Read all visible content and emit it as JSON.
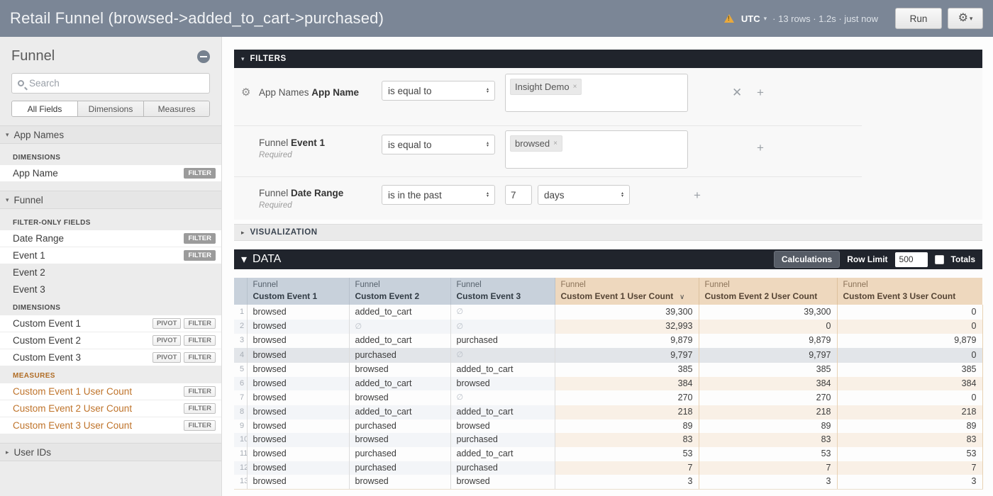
{
  "topbar": {
    "title": "Retail Funnel (browsed->added_to_cart->purchased)",
    "timezone": "UTC",
    "meta": "· 13 rows · 1.2s · just now",
    "run_label": "Run",
    "gear_glyph": "⚙"
  },
  "sidebar": {
    "title": "Funnel",
    "search_placeholder": "Search",
    "tabs": [
      {
        "label": "All Fields",
        "active": true
      },
      {
        "label": "Dimensions",
        "active": false
      },
      {
        "label": "Measures",
        "active": false
      }
    ],
    "groups": [
      {
        "label": "App Names",
        "expanded": true,
        "sections": [
          {
            "heading": "DIMENSIONS",
            "kind": "dimensions",
            "fields": [
              {
                "label": "App Name",
                "selected": true,
                "measure": false,
                "badges": [
                  {
                    "label": "FILTER",
                    "active": true
                  }
                ]
              }
            ]
          }
        ]
      },
      {
        "label": "Funnel",
        "expanded": true,
        "sections": [
          {
            "heading": "FILTER-ONLY FIELDS",
            "kind": "filter-only",
            "fields": [
              {
                "label": "Date Range",
                "selected": true,
                "measure": false,
                "badges": [
                  {
                    "label": "FILTER",
                    "active": true
                  }
                ]
              },
              {
                "label": "Event 1",
                "selected": true,
                "measure": false,
                "badges": [
                  {
                    "label": "FILTER",
                    "active": true
                  }
                ]
              },
              {
                "label": "Event 2",
                "selected": false,
                "measure": false,
                "badges": []
              },
              {
                "label": "Event 3",
                "selected": false,
                "measure": false,
                "badges": []
              }
            ]
          },
          {
            "heading": "DIMENSIONS",
            "kind": "dimensions",
            "fields": [
              {
                "label": "Custom Event 1",
                "selected": true,
                "measure": false,
                "badges": [
                  {
                    "label": "PIVOT",
                    "active": false
                  },
                  {
                    "label": "FILTER",
                    "active": false
                  }
                ]
              },
              {
                "label": "Custom Event 2",
                "selected": true,
                "measure": false,
                "badges": [
                  {
                    "label": "PIVOT",
                    "active": false
                  },
                  {
                    "label": "FILTER",
                    "active": false
                  }
                ]
              },
              {
                "label": "Custom Event 3",
                "selected": true,
                "measure": false,
                "badges": [
                  {
                    "label": "PIVOT",
                    "active": false
                  },
                  {
                    "label": "FILTER",
                    "active": false
                  }
                ]
              }
            ]
          },
          {
            "heading": "MEASURES",
            "kind": "measures",
            "fields": [
              {
                "label": "Custom Event 1 User Count",
                "selected": true,
                "measure": true,
                "badges": [
                  {
                    "label": "FILTER",
                    "active": false
                  }
                ]
              },
              {
                "label": "Custom Event 2 User Count",
                "selected": true,
                "measure": true,
                "badges": [
                  {
                    "label": "FILTER",
                    "active": false
                  }
                ]
              },
              {
                "label": "Custom Event 3 User Count",
                "selected": true,
                "measure": true,
                "badges": [
                  {
                    "label": "FILTER",
                    "active": false
                  }
                ]
              }
            ]
          }
        ]
      },
      {
        "label": "User IDs",
        "expanded": false,
        "sections": []
      }
    ]
  },
  "filters": {
    "title": "FILTERS",
    "rows": [
      {
        "has_gear": true,
        "context": "App Names",
        "field": "App Name",
        "required": "",
        "operator": "is equal to",
        "chips": [
          "Insight Demo"
        ],
        "value": null,
        "unit": null,
        "removable": true
      },
      {
        "has_gear": false,
        "context": "Funnel",
        "field": "Event 1",
        "required": "Required",
        "operator": "is equal to",
        "chips": [
          "browsed"
        ],
        "value": null,
        "unit": null,
        "removable": false
      },
      {
        "has_gear": false,
        "context": "Funnel",
        "field": "Date Range",
        "required": "Required",
        "operator": "is in the past",
        "chips": null,
        "value": "7",
        "unit": "days",
        "removable": false
      }
    ]
  },
  "visualization": {
    "title": "VISUALIZATION"
  },
  "data_section": {
    "title": "DATA",
    "calculations_label": "Calculations",
    "row_limit_label": "Row Limit",
    "row_limit_value": "500",
    "totals_label": "Totals"
  },
  "table": {
    "null_symbol": "∅",
    "columns": [
      {
        "group": "Funnel",
        "name": "Custom Event 1",
        "type": "dimension",
        "sorted": false
      },
      {
        "group": "Funnel",
        "name": "Custom Event 2",
        "type": "dimension",
        "sorted": false
      },
      {
        "group": "Funnel",
        "name": "Custom Event 3",
        "type": "dimension",
        "sorted": false
      },
      {
        "group": "Funnel",
        "name": "Custom Event 1 User Count",
        "type": "measure",
        "sorted": true
      },
      {
        "group": "Funnel",
        "name": "Custom Event 2 User Count",
        "type": "measure",
        "sorted": false
      },
      {
        "group": "Funnel",
        "name": "Custom Event 3 User Count",
        "type": "measure",
        "sorted": false
      }
    ],
    "rows": [
      {
        "n": "1",
        "cells": [
          "browsed",
          "added_to_cart",
          null,
          "39,300",
          "39,300",
          "0"
        ],
        "highlight": false
      },
      {
        "n": "2",
        "cells": [
          "browsed",
          null,
          null,
          "32,993",
          "0",
          "0"
        ],
        "highlight": false
      },
      {
        "n": "3",
        "cells": [
          "browsed",
          "added_to_cart",
          "purchased",
          "9,879",
          "9,879",
          "9,879"
        ],
        "highlight": false
      },
      {
        "n": "4",
        "cells": [
          "browsed",
          "purchased",
          null,
          "9,797",
          "9,797",
          "0"
        ],
        "highlight": true
      },
      {
        "n": "5",
        "cells": [
          "browsed",
          "browsed",
          "added_to_cart",
          "385",
          "385",
          "385"
        ],
        "highlight": false
      },
      {
        "n": "6",
        "cells": [
          "browsed",
          "added_to_cart",
          "browsed",
          "384",
          "384",
          "384"
        ],
        "highlight": false
      },
      {
        "n": "7",
        "cells": [
          "browsed",
          "browsed",
          null,
          "270",
          "270",
          "0"
        ],
        "highlight": false
      },
      {
        "n": "8",
        "cells": [
          "browsed",
          "added_to_cart",
          "added_to_cart",
          "218",
          "218",
          "218"
        ],
        "highlight": false
      },
      {
        "n": "9",
        "cells": [
          "browsed",
          "purchased",
          "browsed",
          "89",
          "89",
          "89"
        ],
        "highlight": false
      },
      {
        "n": "10",
        "cells": [
          "browsed",
          "browsed",
          "purchased",
          "83",
          "83",
          "83"
        ],
        "highlight": false
      },
      {
        "n": "11",
        "cells": [
          "browsed",
          "purchased",
          "added_to_cart",
          "53",
          "53",
          "53"
        ],
        "highlight": false
      },
      {
        "n": "12",
        "cells": [
          "browsed",
          "purchased",
          "purchased",
          "7",
          "7",
          "7"
        ],
        "highlight": false
      },
      {
        "n": "13",
        "cells": [
          "browsed",
          "browsed",
          "browsed",
          "3",
          "3",
          "3"
        ],
        "highlight": false
      }
    ]
  }
}
